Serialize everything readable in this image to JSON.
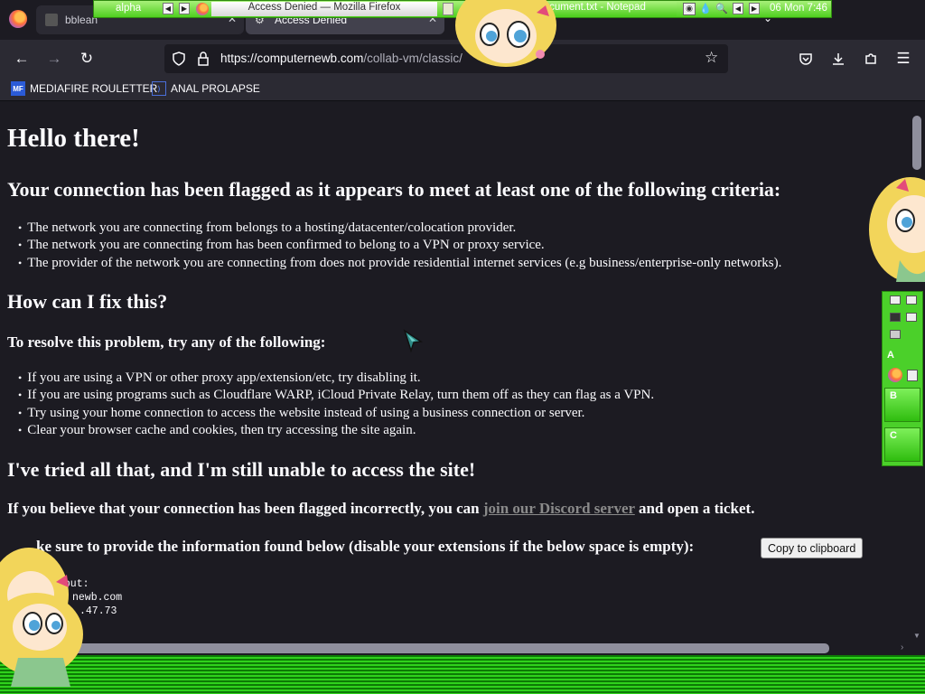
{
  "browser": {
    "tabs": [
      {
        "label": "bblean",
        "active": false
      },
      {
        "label": "Access Denied",
        "active": true
      }
    ],
    "url": {
      "host": "https://computernewb.com",
      "path": "/collab-vm/classic/"
    },
    "bookmarks": [
      {
        "label": "MEDIAFIRE ROULETTER",
        "icon": "mediafire-icon"
      },
      {
        "label": "ANAL PROLAPSE",
        "icon": "bookmark-icon"
      }
    ]
  },
  "page": {
    "h1": "Hello there!",
    "h2_flagged": "Your connection has been flagged as it appears to meet at least one of the following criteria:",
    "criteria": [
      "The network you are connecting from belongs to a hosting/datacenter/colocation provider.",
      "The network you are connecting from has been confirmed to belong to a VPN or proxy service.",
      "The provider of the network you are connecting from does not provide residential internet services (e.g business/enterprise-only networks)."
    ],
    "h2_fix": "How can I fix this?",
    "h3_resolve": "To resolve this problem, try any of the following:",
    "fixes": [
      "If you are using a VPN or other proxy app/extension/etc, try disabling it.",
      "If you are using programs such as Cloudflare WARP, iCloud Private Relay, turn them off as they can flag as a VPN.",
      "Try using your home connection to access the website instead of using a business connection or server.",
      "Clear your browser cache and cookies, then try accessing the site again."
    ],
    "h2_tried": "I've tried all that, and I'm still unable to access the site!",
    "discord_pre": "If you believe that your connection has been flagged incorrectly, you can ",
    "discord_link": "join our Discord server",
    "discord_post": " and open a ticket.",
    "provide_info": "ke sure to provide the information found below (disable your extensions if the below space is empty):",
    "copy_button": "Copy to clipboard",
    "output_lines": [
      "tput:",
      "",
      "",
      "newb.com",
      ".47.73"
    ]
  },
  "taskbar": {
    "workspace": "alpha",
    "windows": [
      "Access Denied — Mozilla Firefox",
      "New Text Document.txt - Notepad"
    ],
    "clock": "06 Mon 7:46"
  },
  "side_panel": {
    "labels": [
      "A",
      "B",
      "C"
    ]
  },
  "colors": {
    "taskbar_green": "#4fcf1f",
    "page_bg": "#1c1b22",
    "link_gray": "#8a8a8a"
  }
}
